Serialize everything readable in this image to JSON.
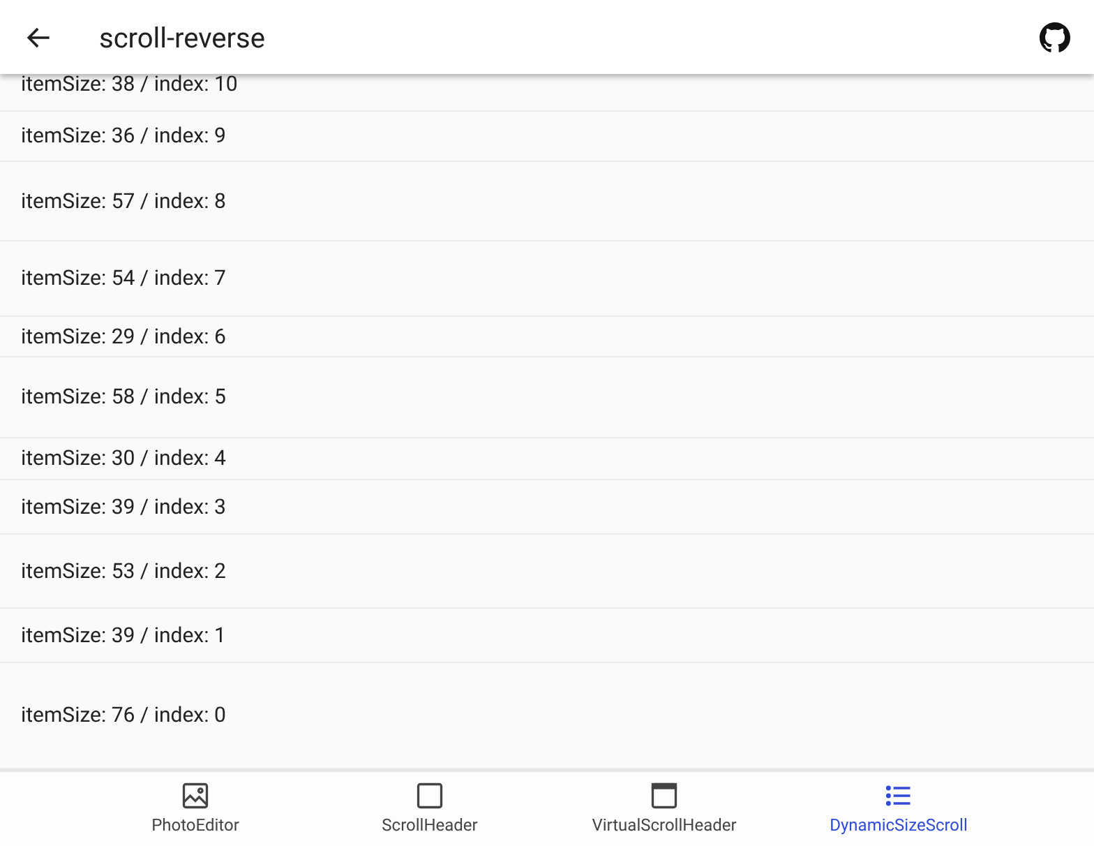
{
  "app_bar": {
    "title": "scroll-reverse"
  },
  "list": {
    "items": [
      {
        "label": "itemSize: 38 / index: 10"
      },
      {
        "label": "itemSize: 36 / index: 9"
      },
      {
        "label": "itemSize: 57 / index: 8"
      },
      {
        "label": "itemSize: 54 / index: 7"
      },
      {
        "label": "itemSize: 29 / index: 6"
      },
      {
        "label": "itemSize: 58 / index: 5"
      },
      {
        "label": "itemSize: 30 / index: 4"
      },
      {
        "label": "itemSize: 39 / index: 3"
      },
      {
        "label": "itemSize: 53 / index: 2"
      },
      {
        "label": "itemSize: 39 / index: 1"
      },
      {
        "label": "itemSize: 76 / index: 0"
      }
    ]
  },
  "bottom_nav": [
    {
      "label": "PhotoEditor",
      "kind": "image",
      "selected": false
    },
    {
      "label": "ScrollHeader",
      "kind": "square",
      "selected": false
    },
    {
      "label": "VirtualScrollHeader",
      "kind": "window",
      "selected": false
    },
    {
      "label": "DynamicSizeScroll",
      "kind": "list",
      "selected": true
    }
  ]
}
